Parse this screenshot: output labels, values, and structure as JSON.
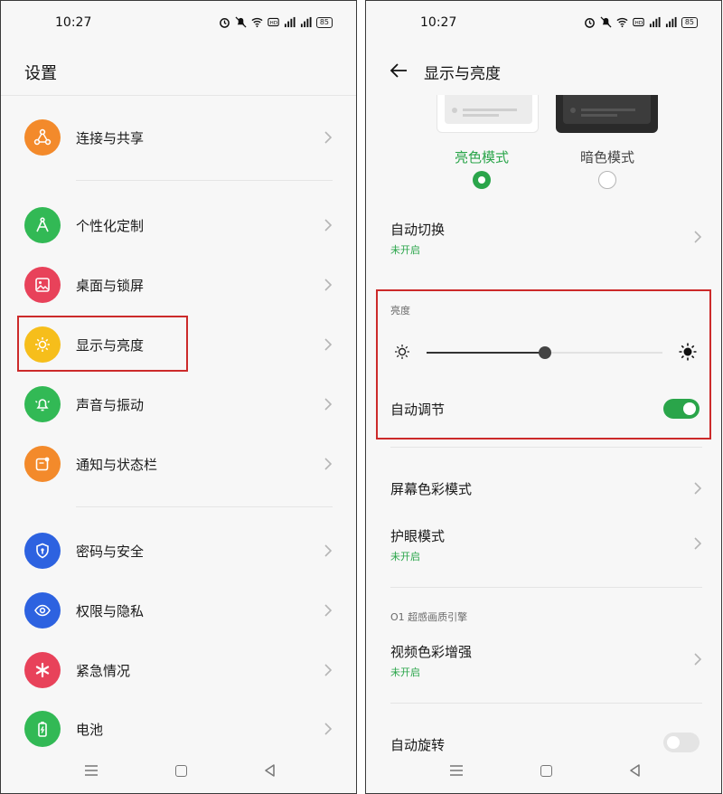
{
  "status": {
    "time": "10:27",
    "battery": "85"
  },
  "left": {
    "title": "设置",
    "items": [
      {
        "label": "连接与共享",
        "icon": "share-icon",
        "color": "#f38a2b"
      },
      {
        "label": "个性化定制",
        "icon": "compass-icon",
        "color": "#32b955"
      },
      {
        "label": "桌面与锁屏",
        "icon": "image-icon",
        "color": "#e8425a"
      },
      {
        "label": "显示与亮度",
        "icon": "brightness-icon",
        "color": "#f6be1b"
      },
      {
        "label": "声音与振动",
        "icon": "bell-icon",
        "color": "#32b955"
      },
      {
        "label": "通知与状态栏",
        "icon": "notification-icon",
        "color": "#f38a2b"
      },
      {
        "label": "密码与安全",
        "icon": "shield-icon",
        "color": "#2d62e0"
      },
      {
        "label": "权限与隐私",
        "icon": "eye-icon",
        "color": "#2d62e0"
      },
      {
        "label": "紧急情况",
        "icon": "emergency-icon",
        "color": "#e8425a"
      },
      {
        "label": "电池",
        "icon": "battery-icon",
        "color": "#32b955"
      }
    ]
  },
  "right": {
    "title": "显示与亮度",
    "theme_light_label": "亮色模式",
    "theme_dark_label": "暗色模式",
    "auto_switch": {
      "title": "自动切换",
      "sub": "未开启"
    },
    "brightness_header": "亮度",
    "brightness_level": 0.5,
    "auto_adjust": {
      "title": "自动调节",
      "on": true
    },
    "screen_color": "屏幕色彩模式",
    "eye_care": {
      "title": "护眼模式",
      "sub": "未开启"
    },
    "engine_header": "O1 超感画质引擎",
    "video_color": {
      "title": "视频色彩增强",
      "sub": "未开启"
    },
    "auto_rotate": {
      "title": "自动旋转",
      "on": false
    }
  },
  "colors": {
    "accent": "#2aa54a",
    "highlight": "#cc2a2a"
  }
}
